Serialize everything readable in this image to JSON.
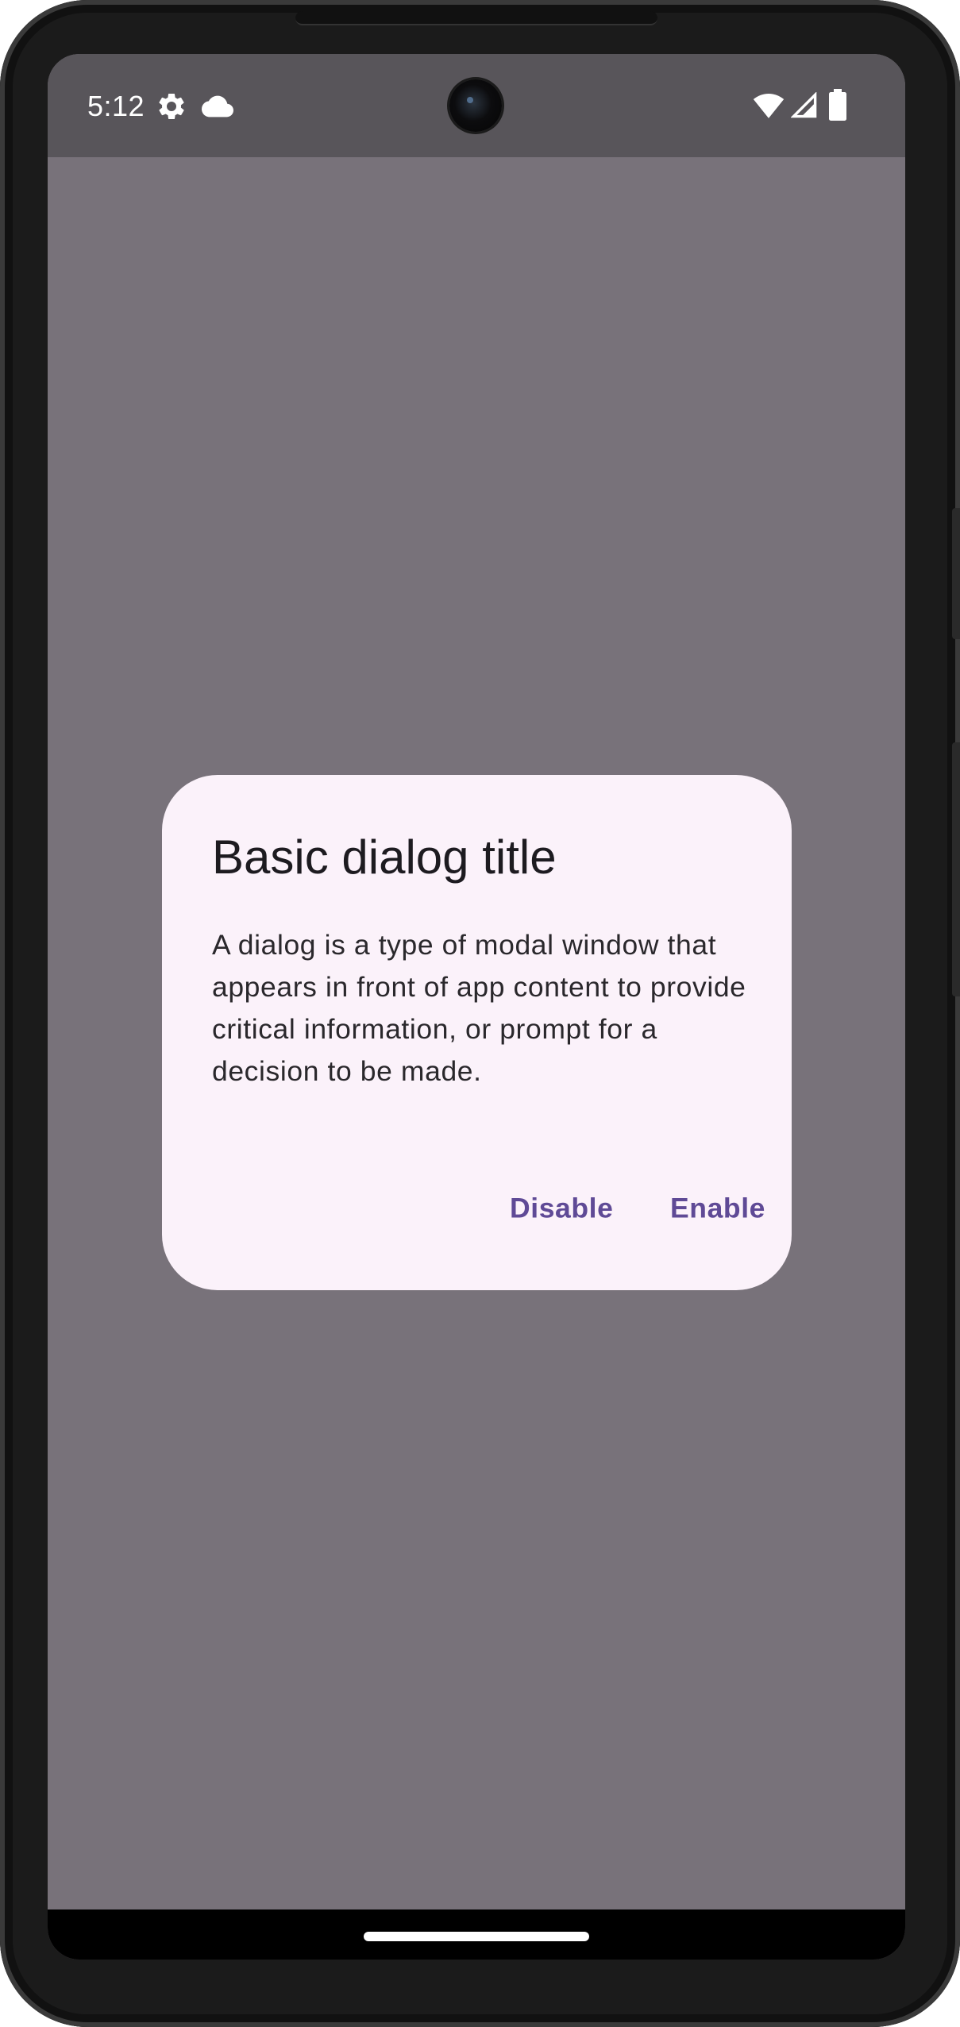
{
  "status_bar": {
    "time": "5:12",
    "left_icons": [
      "settings-gear-icon",
      "cloud-icon"
    ],
    "right_icons": [
      "wifi-icon",
      "signal-icon",
      "battery-icon"
    ]
  },
  "dialog": {
    "title": "Basic dialog title",
    "body": "A dialog is a type of modal window that appears in front of app content to provide critical information, or prompt for a decision to be made.",
    "buttons": {
      "dismiss": "Disable",
      "confirm": "Enable"
    }
  },
  "colors": {
    "scrim": "#78727a",
    "status_bar": "#58555a",
    "dialog_surface": "#fbf2fa",
    "primary": "#5f4a96",
    "on_surface": "#1d1b20"
  }
}
